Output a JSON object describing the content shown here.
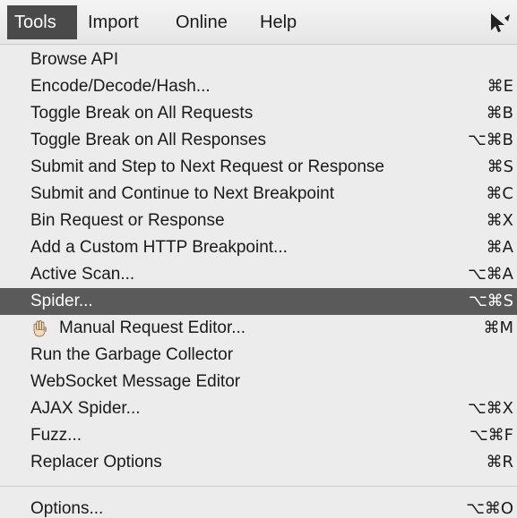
{
  "menubar": {
    "items": [
      {
        "label": "Tools",
        "active": true
      },
      {
        "label": "Import",
        "active": false
      },
      {
        "label": "Online",
        "active": false
      },
      {
        "label": "Help",
        "active": false
      }
    ],
    "trailing_icon": "pointer-cursor-icon"
  },
  "tools_menu": {
    "items": [
      {
        "label": "Browse API",
        "shortcut": ""
      },
      {
        "label": "Encode/Decode/Hash...",
        "shortcut": "⌘E"
      },
      {
        "label": "Toggle Break on All Requests",
        "shortcut": "⌘B"
      },
      {
        "label": "Toggle Break on All Responses",
        "shortcut": "⌥⌘B"
      },
      {
        "label": "Submit and Step to Next Request or Response",
        "shortcut": "⌘S"
      },
      {
        "label": "Submit and Continue to Next Breakpoint",
        "shortcut": "⌘C"
      },
      {
        "label": "Bin Request or Response",
        "shortcut": "⌘X"
      },
      {
        "label": "Add a Custom HTTP Breakpoint...",
        "shortcut": "⌘A"
      },
      {
        "label": "Active Scan...",
        "shortcut": "⌥⌘A"
      },
      {
        "label": "Spider...",
        "shortcut": "⌥⌘S",
        "highlighted": true
      },
      {
        "label": "Manual Request Editor...",
        "shortcut": "⌘M",
        "icon": "hand-icon"
      },
      {
        "label": "Run the Garbage Collector",
        "shortcut": ""
      },
      {
        "label": "WebSocket Message Editor",
        "shortcut": ""
      },
      {
        "label": "AJAX Spider...",
        "shortcut": "⌥⌘X"
      },
      {
        "label": "Fuzz...",
        "shortcut": "⌥⌘F"
      },
      {
        "label": "Replacer Options",
        "shortcut": "⌘R"
      },
      {
        "label": "Options...",
        "shortcut": "⌥⌘O"
      }
    ]
  },
  "colors": {
    "highlight_bg": "#5a5a5a",
    "active_menubar_bg": "#4a4a4a",
    "menu_bg": "#ececec"
  }
}
